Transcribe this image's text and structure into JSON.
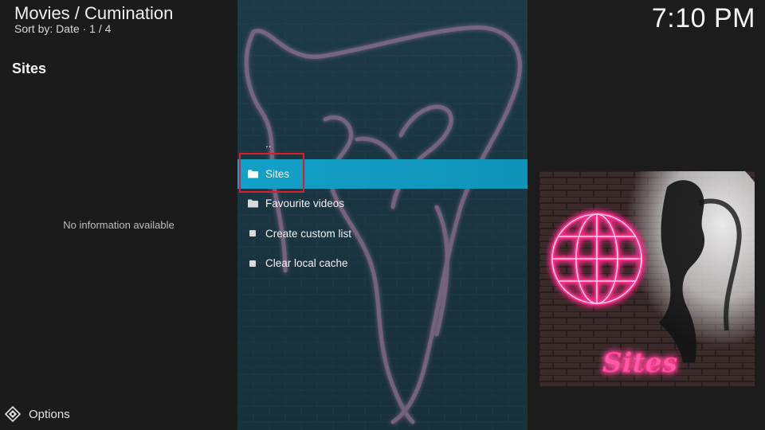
{
  "header": {
    "title": "Movies / Cumination",
    "subtitle": "Sort by: Date  ·  1 / 4"
  },
  "clock": "7:10 PM",
  "info_panel": {
    "section_title": "Sites",
    "empty_message": "No information available"
  },
  "list": {
    "items": [
      {
        "label": "..",
        "icon": "none"
      },
      {
        "label": "Sites",
        "icon": "folder-icon",
        "selected": true
      },
      {
        "label": "Favourite videos",
        "icon": "folder-icon"
      },
      {
        "label": "Create custom list",
        "icon": "square-bullet-icon"
      },
      {
        "label": "Clear local cache",
        "icon": "square-bullet-icon"
      }
    ]
  },
  "thumbnail": {
    "caption": "Sites",
    "icon": "neon-globe-icon"
  },
  "footer": {
    "options_label": "Options",
    "options_icon": "options-diamond-icon"
  },
  "colors": {
    "selection": "#13a1c8",
    "highlight_box": "#d81f2a",
    "neon_pink": "#ff2d8a"
  }
}
